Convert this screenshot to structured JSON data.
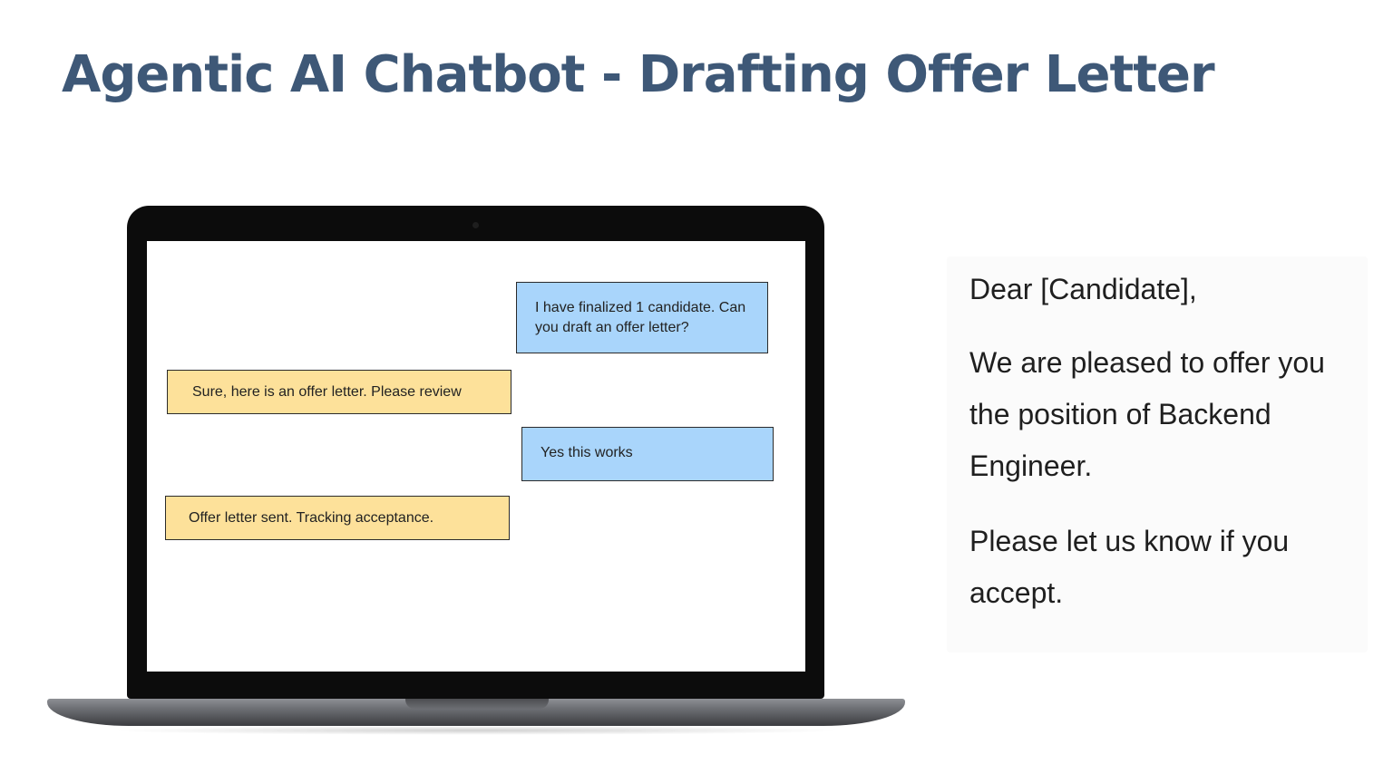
{
  "slide": {
    "title": "Agentic AI Chatbot - Drafting Offer Letter"
  },
  "chat": {
    "messages": [
      {
        "sender": "user",
        "text": "I have finalized 1 candidate. Can you draft an offer letter?"
      },
      {
        "sender": "bot",
        "text": "Sure, here is an offer letter. Please review"
      },
      {
        "sender": "user",
        "text": "Yes this works"
      },
      {
        "sender": "bot",
        "text": "Offer letter sent. Tracking acceptance."
      }
    ]
  },
  "letter": {
    "greeting": "Dear [Candidate],",
    "body": "We are pleased to offer you the position of Backend Engineer.",
    "closing": "Please let us know if you accept."
  },
  "colors": {
    "title": "#3e5877",
    "user_bubble": "#a9d5fb",
    "bot_bubble": "#fde19a",
    "laptop_frame": "#0c0c0c"
  }
}
